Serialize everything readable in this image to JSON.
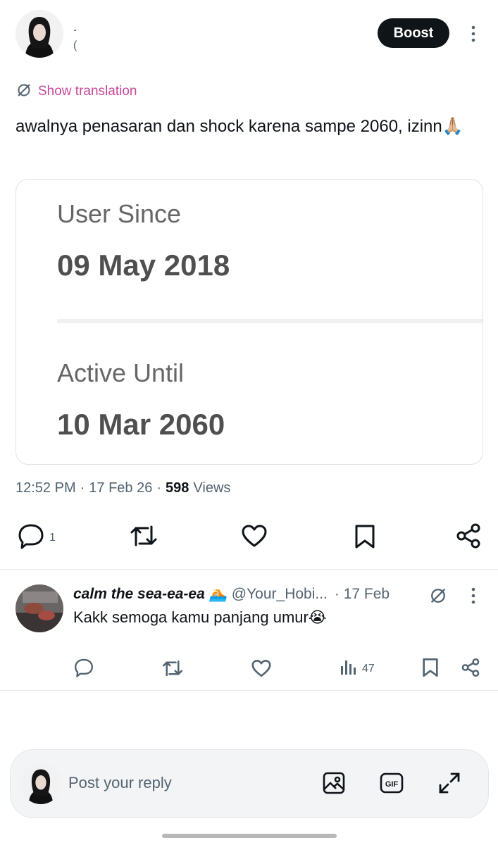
{
  "post": {
    "author_name": "˼",
    "author_handle": "(",
    "boost_label": "Boost",
    "show_translation": "Show translation",
    "text": "awalnya penasaran dan shock karena sampe 2060, izinn🙏🏼",
    "card": {
      "user_since_label": "User Since",
      "user_since_value": "09 May 2018",
      "active_until_label": "Active Until",
      "active_until_value": "10 Mar 2060"
    },
    "time": "12:52 PM",
    "date": "17 Feb 26",
    "views_count": "598",
    "views_label": "Views",
    "reply_count": "1"
  },
  "reply": {
    "name": "calm the sea-ea-ea 🏊🏻",
    "handle": "@Your_Hobi...",
    "date": "· 17 Feb",
    "text": "Kakk semoga kamu panjang umur😭",
    "views_count": "47"
  },
  "composer": {
    "placeholder": "Post your reply"
  },
  "icons": {
    "translate": "translate-icon",
    "reply": "reply-icon",
    "repost": "repost-icon",
    "like": "heart-icon",
    "bookmark": "bookmark-icon",
    "share": "share-icon",
    "views": "views-icon",
    "image": "image-icon",
    "gif": "gif-icon",
    "expand": "expand-icon",
    "more": "more-vertical-icon"
  },
  "colors": {
    "accent_translate": "#c8489a",
    "text_primary": "#0f1419",
    "text_secondary": "#536471",
    "boost_bg": "#0f1419"
  }
}
